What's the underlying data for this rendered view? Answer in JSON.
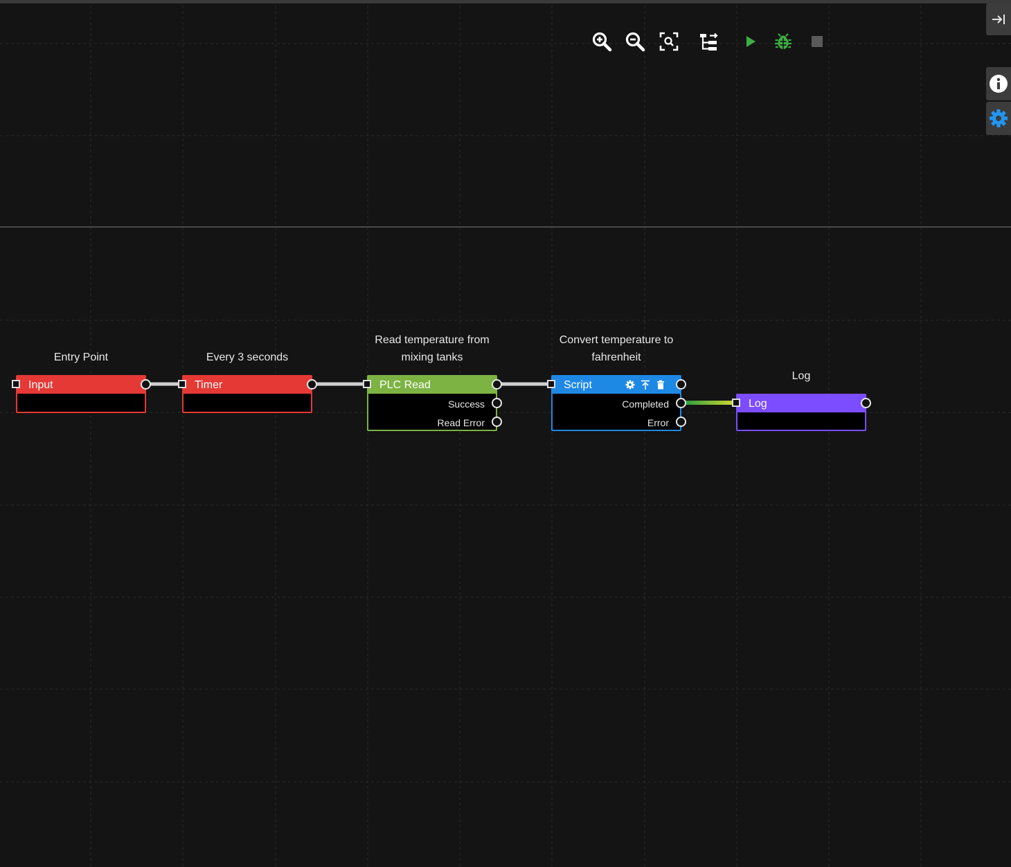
{
  "toolbar": {
    "buttons": [
      {
        "name": "zoom-in-button",
        "icon": "zoom-in-icon"
      },
      {
        "name": "zoom-out-button",
        "icon": "zoom-out-icon"
      },
      {
        "name": "zoom-fit-button",
        "icon": "zoom-fit-icon"
      },
      {
        "name": "auto-layout-button",
        "icon": "layout-icon"
      },
      {
        "name": "run-button",
        "icon": "play-icon",
        "color": "#3cb043"
      },
      {
        "name": "debug-button",
        "icon": "bug-icon",
        "color": "#3cb043"
      },
      {
        "name": "stop-button",
        "icon": "stop-icon",
        "color": "#5a5a5a"
      }
    ]
  },
  "side_panel": {
    "collapse_icon": "collapse-right-icon",
    "info_icon": "info-icon",
    "settings_icon": "gear-icon",
    "settings_color": "#2196f3"
  },
  "nodes": [
    {
      "id": "input",
      "title": "Entry Point",
      "label": "Input",
      "color": "#e53935",
      "outputs": []
    },
    {
      "id": "timer",
      "title": "Every 3 seconds",
      "label": "Timer",
      "color": "#e53935",
      "outputs": []
    },
    {
      "id": "plc",
      "title_line1": "Read temperature from",
      "title_line2": "mixing tanks",
      "label": "PLC Read",
      "color": "#7cb342",
      "outputs": [
        "Success",
        "Read Error"
      ]
    },
    {
      "id": "script",
      "title_line1": "Convert temperature to",
      "title_line2": "fahrenheit",
      "label": "Script",
      "color": "#1e88e5",
      "outputs": [
        "Completed",
        "Error"
      ],
      "tools": [
        "gear-icon",
        "pin-top-icon",
        "trash-icon"
      ]
    },
    {
      "id": "log",
      "title": "Log",
      "label": "Log",
      "color": "#7c4dff",
      "outputs": []
    }
  ],
  "connections": [
    {
      "from": "input",
      "to": "timer",
      "color": "#d0d0d0"
    },
    {
      "from": "timer",
      "to": "plc",
      "color": "#d0d0d0"
    },
    {
      "from": "plc",
      "to": "script",
      "color": "#d0d0d0"
    },
    {
      "from": "script.Completed",
      "to": "log",
      "color_start": "#2e9e3e",
      "color_end": "#c8d630"
    }
  ]
}
